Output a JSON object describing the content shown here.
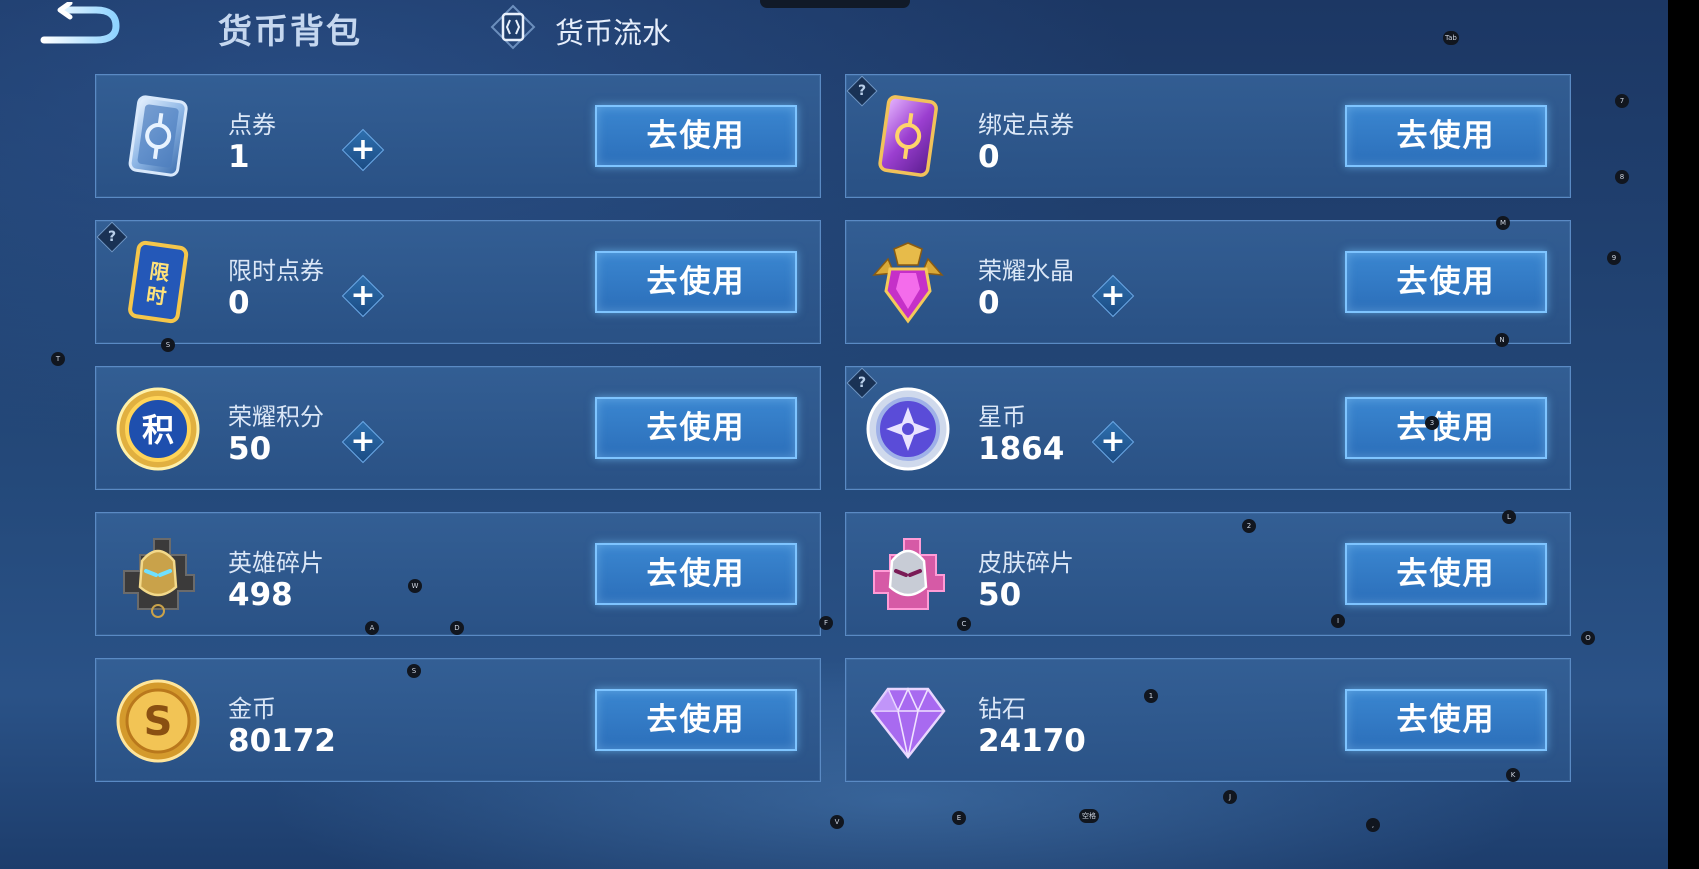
{
  "header": {
    "title": "货币背包",
    "flow_link": "货币流水",
    "back_icon": "back-arrow-icon",
    "flow_icon": "ledger-diamond-icon"
  },
  "currencies": [
    {
      "name": "点券",
      "value": "1",
      "button": "去使用",
      "icon": "voucher-card-icon",
      "has_plus": true,
      "has_help": false
    },
    {
      "name": "绑定点券",
      "value": "0",
      "button": "去使用",
      "icon": "bound-voucher-card-icon",
      "has_plus": false,
      "has_help": true
    },
    {
      "name": "限时点券",
      "value": "0",
      "button": "去使用",
      "icon": "limited-voucher-card-icon",
      "icon_text": "限时",
      "has_plus": true,
      "has_help": true
    },
    {
      "name": "荣耀水晶",
      "value": "0",
      "button": "去使用",
      "icon": "glory-crystal-icon",
      "has_plus": true,
      "has_help": false
    },
    {
      "name": "荣耀积分",
      "value": "50",
      "button": "去使用",
      "icon": "glory-points-coin-icon",
      "icon_text": "积",
      "has_plus": true,
      "has_help": false
    },
    {
      "name": "星币",
      "value": "1864",
      "button": "去使用",
      "icon": "star-coin-icon",
      "has_plus": true,
      "has_help": true
    },
    {
      "name": "英雄碎片",
      "value": "498",
      "button": "去使用",
      "icon": "hero-fragment-helmet-icon",
      "has_plus": false,
      "has_help": false
    },
    {
      "name": "皮肤碎片",
      "value": "50",
      "button": "去使用",
      "icon": "skin-fragment-helmet-icon",
      "has_plus": false,
      "has_help": false
    },
    {
      "name": "金币",
      "value": "80172",
      "button": "去使用",
      "icon": "gold-coin-icon",
      "icon_text": "S",
      "has_plus": false,
      "has_help": false
    },
    {
      "name": "钻石",
      "value": "24170",
      "button": "去使用",
      "icon": "diamond-icon",
      "has_plus": false,
      "has_help": false
    }
  ],
  "help_glyph": "?",
  "plus_glyph": "+",
  "key_hints": [
    "Tab",
    "7",
    "8",
    "M",
    "9",
    "T",
    "S",
    "N",
    "3",
    "2",
    "L",
    "W",
    "A",
    "D",
    "F",
    "C",
    "I",
    "O",
    "S",
    "1",
    "K",
    "J",
    "V",
    "E",
    "空格",
    ","
  ]
}
